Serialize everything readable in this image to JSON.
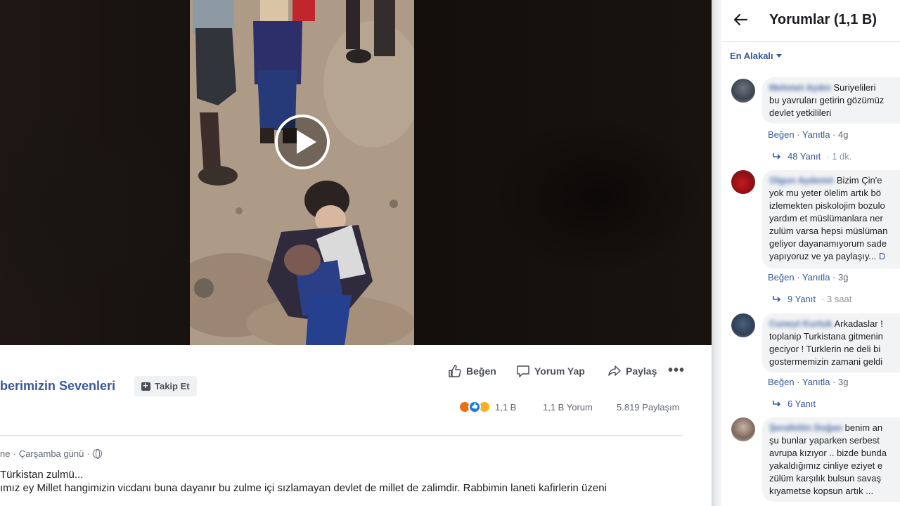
{
  "video": {
    "state": "paused"
  },
  "post": {
    "page_name": "berimizin Sevenleri",
    "follow_label": "Takip Et",
    "actions": {
      "like": "Beğen",
      "comment": "Yorum Yap",
      "share": "Paylaş",
      "more": "•••"
    },
    "stats": {
      "reactions_count": "1,1 B",
      "comments": "1,1 B Yorum",
      "shares": "5.819 Paylaşım"
    },
    "meta": {
      "author_fragment": "ne",
      "separator": "·",
      "date": "Çarşamba günü",
      "privacy_separator": "·"
    },
    "title": "Türkistan zulmü...",
    "body": "ımız ey Millet hangimizin vicdanı buna dayanır bu zulme içi sızlamayan devlet de millet de zalimdir. Rabbimin laneti kafirlerin üzeni"
  },
  "comments_panel": {
    "title": "Yorumlar (1,1 B)",
    "sort_label": "En Alakalı",
    "comments": [
      {
        "author": "Mehmet Aydın",
        "text": "Suriyelileri\nbu yavruları getirin gözümüz\ndevlet yetkilileri",
        "like": "Beğen",
        "reply": "Yanıtla",
        "time": "4g",
        "replies": "48 Yanıt",
        "replies_time": "· 1 dk."
      },
      {
        "author": "Olgun Aydemir",
        "text": "Bizim Çin'e\nyok mu yeter ölelim artık bö\nizlemekten piskolojim bozulo\nyardım et müslümanlara ner\nzulüm varsa hepsi müslüman\ngeliyor dayanamıyorum sade\nyapıyoruz ve ya paylaşıy...",
        "more": "D",
        "like": "Beğen",
        "reply": "Yanıtla",
        "time": "3g",
        "replies": "9 Yanıt",
        "replies_time": "· 3 saat"
      },
      {
        "author": "Cuneyt Kurtuk",
        "text": "Arkadaslar !\ntoplanip Turkistana gitmenin\ngeciyor ! Turklerin ne deli bi\ngostermemizin zamani geldi",
        "like": "Beğen",
        "reply": "Yanıtla",
        "time": "3g",
        "replies": "6 Yanıt",
        "replies_time": ""
      },
      {
        "author": "Şerafettin Doğan",
        "text": "benim an\nşu bunlar yaparken serbest\navrupa kızıyor .. bizde bunda\nyakaldığımız cinliye eziyet e\nzülüm karşılık bulsun savaş\nkıyametse kopsun artık ...",
        "like": "",
        "reply": "",
        "time": "",
        "replies": "",
        "replies_time": ""
      }
    ]
  },
  "colors": {
    "link_blue": "#385898",
    "panel_bg": "#ffffff",
    "bubble_bg": "#f2f3f5",
    "video_bg": "#130e0c"
  }
}
